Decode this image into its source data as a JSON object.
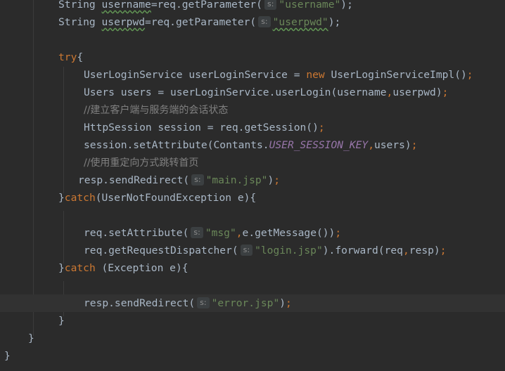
{
  "colors": {
    "background": "#2b2b2b",
    "text": "#a9b7c6",
    "keyword": "#cc7832",
    "string": "#6a8759",
    "comment": "#808080",
    "constant": "#9876aa",
    "hint_background": "#3b3f41"
  },
  "editor": {
    "lines": [
      {
        "text": "        String ",
        "tokens": [
          {
            "t": "String ",
            "c": ""
          },
          {
            "t": "username",
            "c": "",
            "u": true
          },
          {
            "t": "=req.getParameter(",
            "c": ""
          },
          {
            "hint": "s:"
          },
          {
            "t": "\"username\"",
            "c": "str"
          },
          {
            "t": ");",
            "c": ""
          }
        ]
      },
      {
        "tokens": [
          {
            "t": "String ",
            "c": ""
          },
          {
            "t": "userpwd",
            "c": "",
            "u": true
          },
          {
            "t": "=req.getParameter(",
            "c": ""
          },
          {
            "hint": "s:"
          },
          {
            "t": "\"userpwd\"",
            "c": "str",
            "u": true
          },
          {
            "t": ");",
            "c": ""
          }
        ]
      },
      {
        "tokens": []
      },
      {
        "tokens": [
          {
            "t": "try",
            "c": "kw"
          },
          {
            "t": "{",
            "c": ""
          }
        ]
      },
      {
        "tokens": [
          {
            "t": "UserLoginService userLoginService = ",
            "c": ""
          },
          {
            "t": "new ",
            "c": "kw"
          },
          {
            "t": "UserLoginServiceImpl()",
            "c": ""
          },
          {
            "t": ";",
            "c": "kw"
          }
        ]
      },
      {
        "tokens": [
          {
            "t": "Users users = userLoginService.userLogin(username",
            "c": ""
          },
          {
            "t": ",",
            "c": "kw"
          },
          {
            "t": "userpwd)",
            "c": ""
          },
          {
            "t": ";",
            "c": "kw"
          }
        ]
      },
      {
        "tokens": [
          {
            "t": "//建立客户端与服务端的会话状态",
            "c": "cmt"
          }
        ]
      },
      {
        "tokens": [
          {
            "t": "HttpSession session = req.getSession()",
            "c": ""
          },
          {
            "t": ";",
            "c": "kw"
          }
        ]
      },
      {
        "tokens": [
          {
            "t": "session.setAttribute(Contants.",
            "c": ""
          },
          {
            "t": "USER_SESSION_KEY",
            "c": "cst"
          },
          {
            "t": ",",
            "c": "kw"
          },
          {
            "t": "users)",
            "c": ""
          },
          {
            "t": ";",
            "c": "kw"
          }
        ]
      },
      {
        "tokens": [
          {
            "t": "//使用重定向方式跳转首页",
            "c": "cmt"
          }
        ]
      },
      {
        "tokens": [
          {
            "t": "resp.sendRedirect(",
            "c": ""
          },
          {
            "hint": "s:"
          },
          {
            "t": "\"main.jsp\"",
            "c": "str"
          },
          {
            "t": ")",
            "c": ""
          },
          {
            "t": ";",
            "c": "kw"
          }
        ]
      },
      {
        "tokens": [
          {
            "t": "}",
            "c": ""
          },
          {
            "t": "catch",
            "c": "kw"
          },
          {
            "t": "(UserNotFoundException e){",
            "c": ""
          }
        ]
      },
      {
        "tokens": []
      },
      {
        "tokens": [
          {
            "t": "req.setAttribute(",
            "c": ""
          },
          {
            "hint": "s:"
          },
          {
            "t": "\"msg\"",
            "c": "str"
          },
          {
            "t": ",",
            "c": "kw"
          },
          {
            "t": "e.getMessage())",
            "c": ""
          },
          {
            "t": ";",
            "c": "kw"
          }
        ]
      },
      {
        "tokens": [
          {
            "t": "req.getRequestDispatcher(",
            "c": ""
          },
          {
            "hint": "s:"
          },
          {
            "t": "\"login.jsp\"",
            "c": "str"
          },
          {
            "t": ").forward(req",
            "c": ""
          },
          {
            "t": ",",
            "c": "kw"
          },
          {
            "t": "resp)",
            "c": ""
          },
          {
            "t": ";",
            "c": "kw"
          }
        ]
      },
      {
        "tokens": [
          {
            "t": "}",
            "c": ""
          },
          {
            "t": "catch ",
            "c": "kw"
          },
          {
            "t": "(Exception e){",
            "c": ""
          }
        ]
      },
      {
        "tokens": []
      },
      {
        "tokens": [
          {
            "t": "resp.sendRedirect(",
            "c": ""
          },
          {
            "hint": "s:"
          },
          {
            "t": "\"error.jsp\"",
            "c": "str"
          },
          {
            "t": ")",
            "c": ""
          },
          {
            "t": ";",
            "c": "kw"
          }
        ]
      },
      {
        "tokens": [
          {
            "t": "}",
            "c": ""
          }
        ]
      },
      {
        "tokens": [
          {
            "t": "}",
            "c": ""
          }
        ]
      },
      {
        "tokens": [
          {
            "t": "}",
            "c": ""
          }
        ]
      }
    ]
  }
}
